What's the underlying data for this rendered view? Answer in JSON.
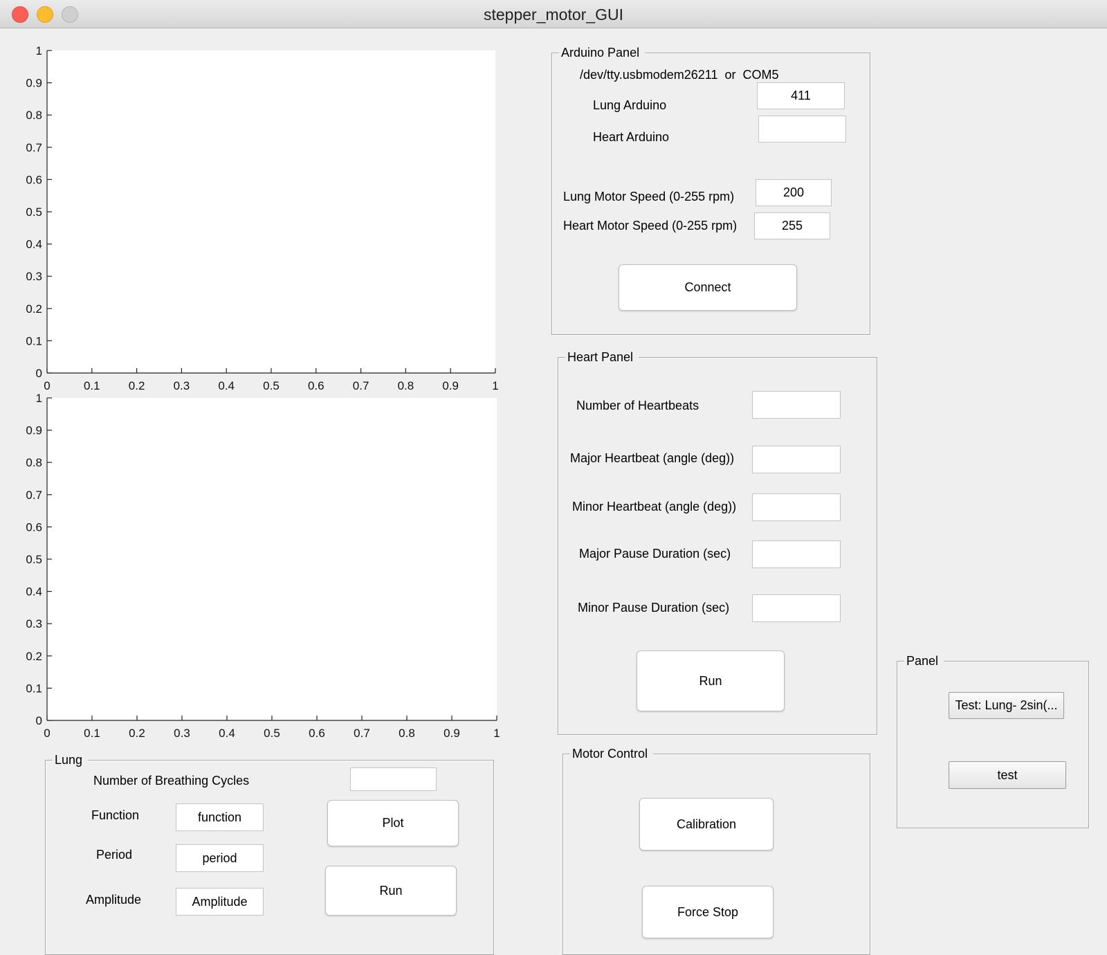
{
  "window": {
    "title": "stepper_motor_GUI"
  },
  "axes_top": {
    "yticks": [
      "1",
      "0.9",
      "0.8",
      "0.7",
      "0.6",
      "0.5",
      "0.4",
      "0.3",
      "0.2",
      "0.1",
      "0"
    ],
    "xticks": [
      "0",
      "0.1",
      "0.2",
      "0.3",
      "0.4",
      "0.5",
      "0.6",
      "0.7",
      "0.8",
      "0.9",
      "1"
    ]
  },
  "axes_bottom": {
    "yticks": [
      "1",
      "0.9",
      "0.8",
      "0.7",
      "0.6",
      "0.5",
      "0.4",
      "0.3",
      "0.2",
      "0.1",
      "0"
    ],
    "xticks": [
      "0",
      "0.1",
      "0.2",
      "0.3",
      "0.4",
      "0.5",
      "0.6",
      "0.7",
      "0.8",
      "0.9",
      "1"
    ]
  },
  "arduino_panel": {
    "title": "Arduino Panel",
    "port_hint": "/dev/tty.usbmodem26211  or  COM5",
    "lung_arduino_label": "Lung Arduino",
    "lung_arduino_value": "411",
    "heart_arduino_label": "Heart Arduino",
    "heart_arduino_value": "",
    "lung_speed_label": "Lung Motor Speed (0-255 rpm)",
    "lung_speed_value": "200",
    "heart_speed_label": "Heart Motor Speed (0-255 rpm)",
    "heart_speed_value": "255",
    "connect_label": "Connect"
  },
  "heart_panel": {
    "title": "Heart Panel",
    "heartbeats_label": "Number of Heartbeats",
    "major_angle_label": "Major Heartbeat (angle (deg))",
    "minor_angle_label": "Minor Heartbeat (angle (deg))",
    "major_pause_label": "Major Pause Duration (sec)",
    "minor_pause_label": "Minor Pause Duration (sec)",
    "heartbeats_value": "",
    "major_angle_value": "",
    "minor_angle_value": "",
    "major_pause_value": "",
    "minor_pause_value": "",
    "run_label": "Run"
  },
  "lung_panel": {
    "title": "Lung",
    "cycles_label": "Number of Breathing Cycles",
    "cycles_value": "",
    "function_label": "Function",
    "function_value": "function",
    "period_label": "Period",
    "period_value": "period",
    "amplitude_label": "Amplitude",
    "amplitude_value": "Amplitude",
    "plot_label": "Plot",
    "run_label": "Run"
  },
  "motor_control": {
    "title": "Motor Control",
    "calibration_label": "Calibration",
    "force_stop_label": "Force Stop"
  },
  "side_panel": {
    "title": "Panel",
    "test_lung_label": "Test: Lung- 2sin(...",
    "test_label": "test"
  }
}
